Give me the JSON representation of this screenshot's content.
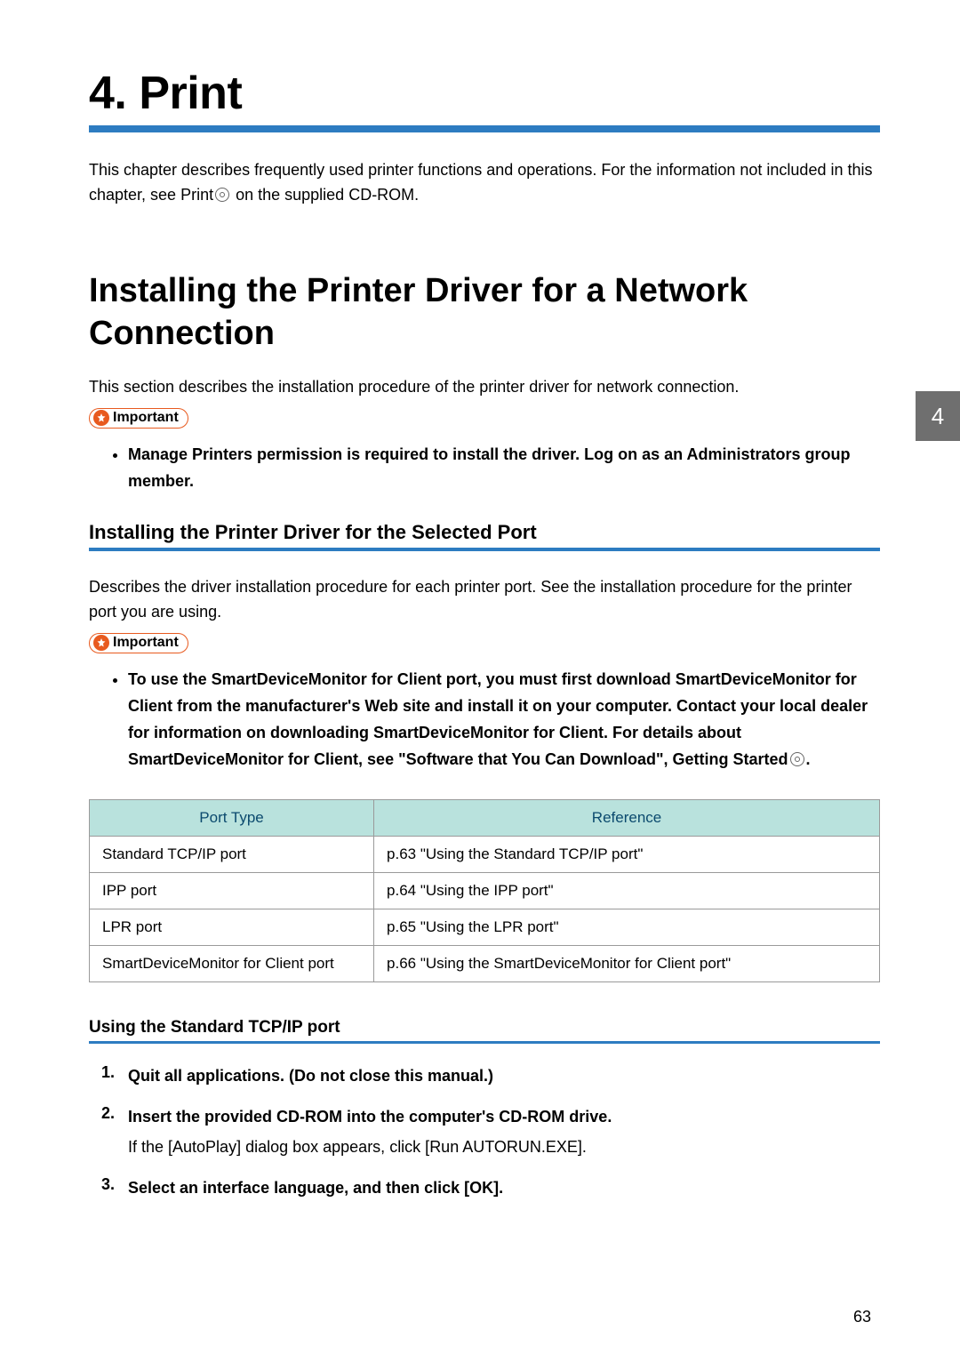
{
  "chapter": {
    "title": "4. Print",
    "intro1": "This chapter describes frequently used printer functions and operations. For the information not included in this chapter, see Print",
    "intro2": " on the supplied CD-ROM."
  },
  "section": {
    "title": "Installing the Printer Driver for a Network Connection",
    "intro": "This section describes the installation procedure of the printer driver for network connection.",
    "important_label": "Important",
    "important_items": [
      "Manage Printers permission is required to install the driver. Log on as an Administrators group member."
    ]
  },
  "subsection": {
    "title": "Installing the Printer Driver for the Selected Port",
    "intro": "Describes the driver installation procedure for each printer port. See the installation procedure for the printer port you are using.",
    "important_label": "Important",
    "important_items": [
      "To use the SmartDeviceMonitor for Client port, you must first download SmartDeviceMonitor for Client from the manufacturer's Web site and install it on your computer. Contact your local dealer for information on downloading SmartDeviceMonitor for Client. For details about SmartDeviceMonitor for Client, see \"Software that You Can Download\", Getting Started"
    ],
    "important_tail": "."
  },
  "table": {
    "headers": [
      "Port Type",
      "Reference"
    ],
    "rows": [
      {
        "port": "Standard TCP/IP port",
        "ref": "p.63 \"Using the Standard TCP/IP port\""
      },
      {
        "port": "IPP port",
        "ref": "p.64 \"Using the IPP port\""
      },
      {
        "port": "LPR port",
        "ref": "p.65 \"Using the LPR port\""
      },
      {
        "port": "SmartDeviceMonitor for Client port",
        "ref": "p.66 \"Using the SmartDeviceMonitor for Client port\""
      }
    ]
  },
  "subsub": {
    "title": "Using the Standard TCP/IP port",
    "steps": [
      {
        "title": "Quit all applications. (Do not close this manual.)",
        "body": ""
      },
      {
        "title": "Insert the provided CD-ROM into the computer's CD-ROM drive.",
        "body": "If the [AutoPlay] dialog box appears, click [Run AUTORUN.EXE]."
      },
      {
        "title": "Select an interface language, and then click [OK].",
        "body": ""
      }
    ]
  },
  "page_tab": "4",
  "page_number": "63"
}
